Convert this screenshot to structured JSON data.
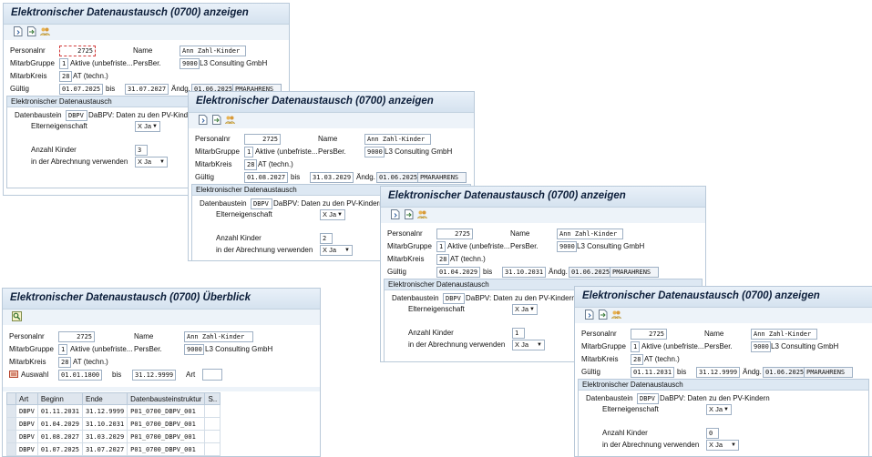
{
  "labels": {
    "personalnr": "Personalnr",
    "name": "Name",
    "mitarbgruppe": "MitarbGruppe",
    "persber": "PersBer.",
    "mitarbkreis": "MitarbKreis",
    "gueltig": "Gültig",
    "bis": "bis",
    "aendg": "Ändg.",
    "section": "Elektronischer Datenaustausch",
    "datenbaustein": "Datenbaustein",
    "elterneigenschaft": "Elterneigenschaft",
    "anzahl_kinder": "Anzahl Kinder",
    "abrechnung": "in der Abrechnung verwenden",
    "auswahl": "Auswahl",
    "art": "Art"
  },
  "common": {
    "personalnr": "2725",
    "name": "Ann Zahl-Kinder",
    "gruppe_code": "1",
    "gruppe_text": "Aktive (unbefriste...",
    "persber_code": "9000",
    "persber_text": "L3 Consulting GmbH",
    "kreis_code": "28",
    "kreis_text": "AT (techn.)",
    "changed_by": "PMARAHRENS",
    "baustein_code": "DBPV",
    "baustein_text": "DaBPV: Daten zu den PV-Kindern",
    "ja": "X Ja"
  },
  "windows": [
    {
      "title": "Elektronischer Datenaustausch (0700) anzeigen",
      "from": "01.07.2025",
      "to": "31.07.2027",
      "changed": "01.06.2025",
      "kinder": "3"
    },
    {
      "title": "Elektronischer Datenaustausch (0700) anzeigen",
      "from": "01.08.2027",
      "to": "31.03.2029",
      "changed": "01.06.2025",
      "kinder": "2"
    },
    {
      "title": "Elektronischer Datenaustausch (0700) anzeigen",
      "from": "01.04.2029",
      "to": "31.10.2031",
      "changed": "01.06.2025",
      "kinder": "1"
    },
    {
      "title": "Elektronischer Datenaustausch (0700) anzeigen",
      "from": "01.11.2031",
      "to": "31.12.9999",
      "changed": "01.06.2025",
      "kinder": "0"
    }
  ],
  "overview": {
    "title": "Elektronischer Datenaustausch (0700) Überblick",
    "auswahl_from": "01.01.1800",
    "auswahl_to": "31.12.9999",
    "art_value": "",
    "columns": [
      "Art",
      "Beginn",
      "Ende",
      "Datenbausteinstruktur",
      "S.."
    ],
    "rows": [
      [
        "DBPV",
        "01.11.2031",
        "31.12.9999",
        "P01_0700_DBPV_001",
        ""
      ],
      [
        "DBPV",
        "01.04.2029",
        "31.10.2031",
        "P01_0700_DBPV_001",
        ""
      ],
      [
        "DBPV",
        "01.08.2027",
        "31.03.2029",
        "P01_0700_DBPV_001",
        ""
      ],
      [
        "DBPV",
        "01.07.2025",
        "31.07.2027",
        "P01_0700_DBPV_001",
        ""
      ]
    ]
  }
}
